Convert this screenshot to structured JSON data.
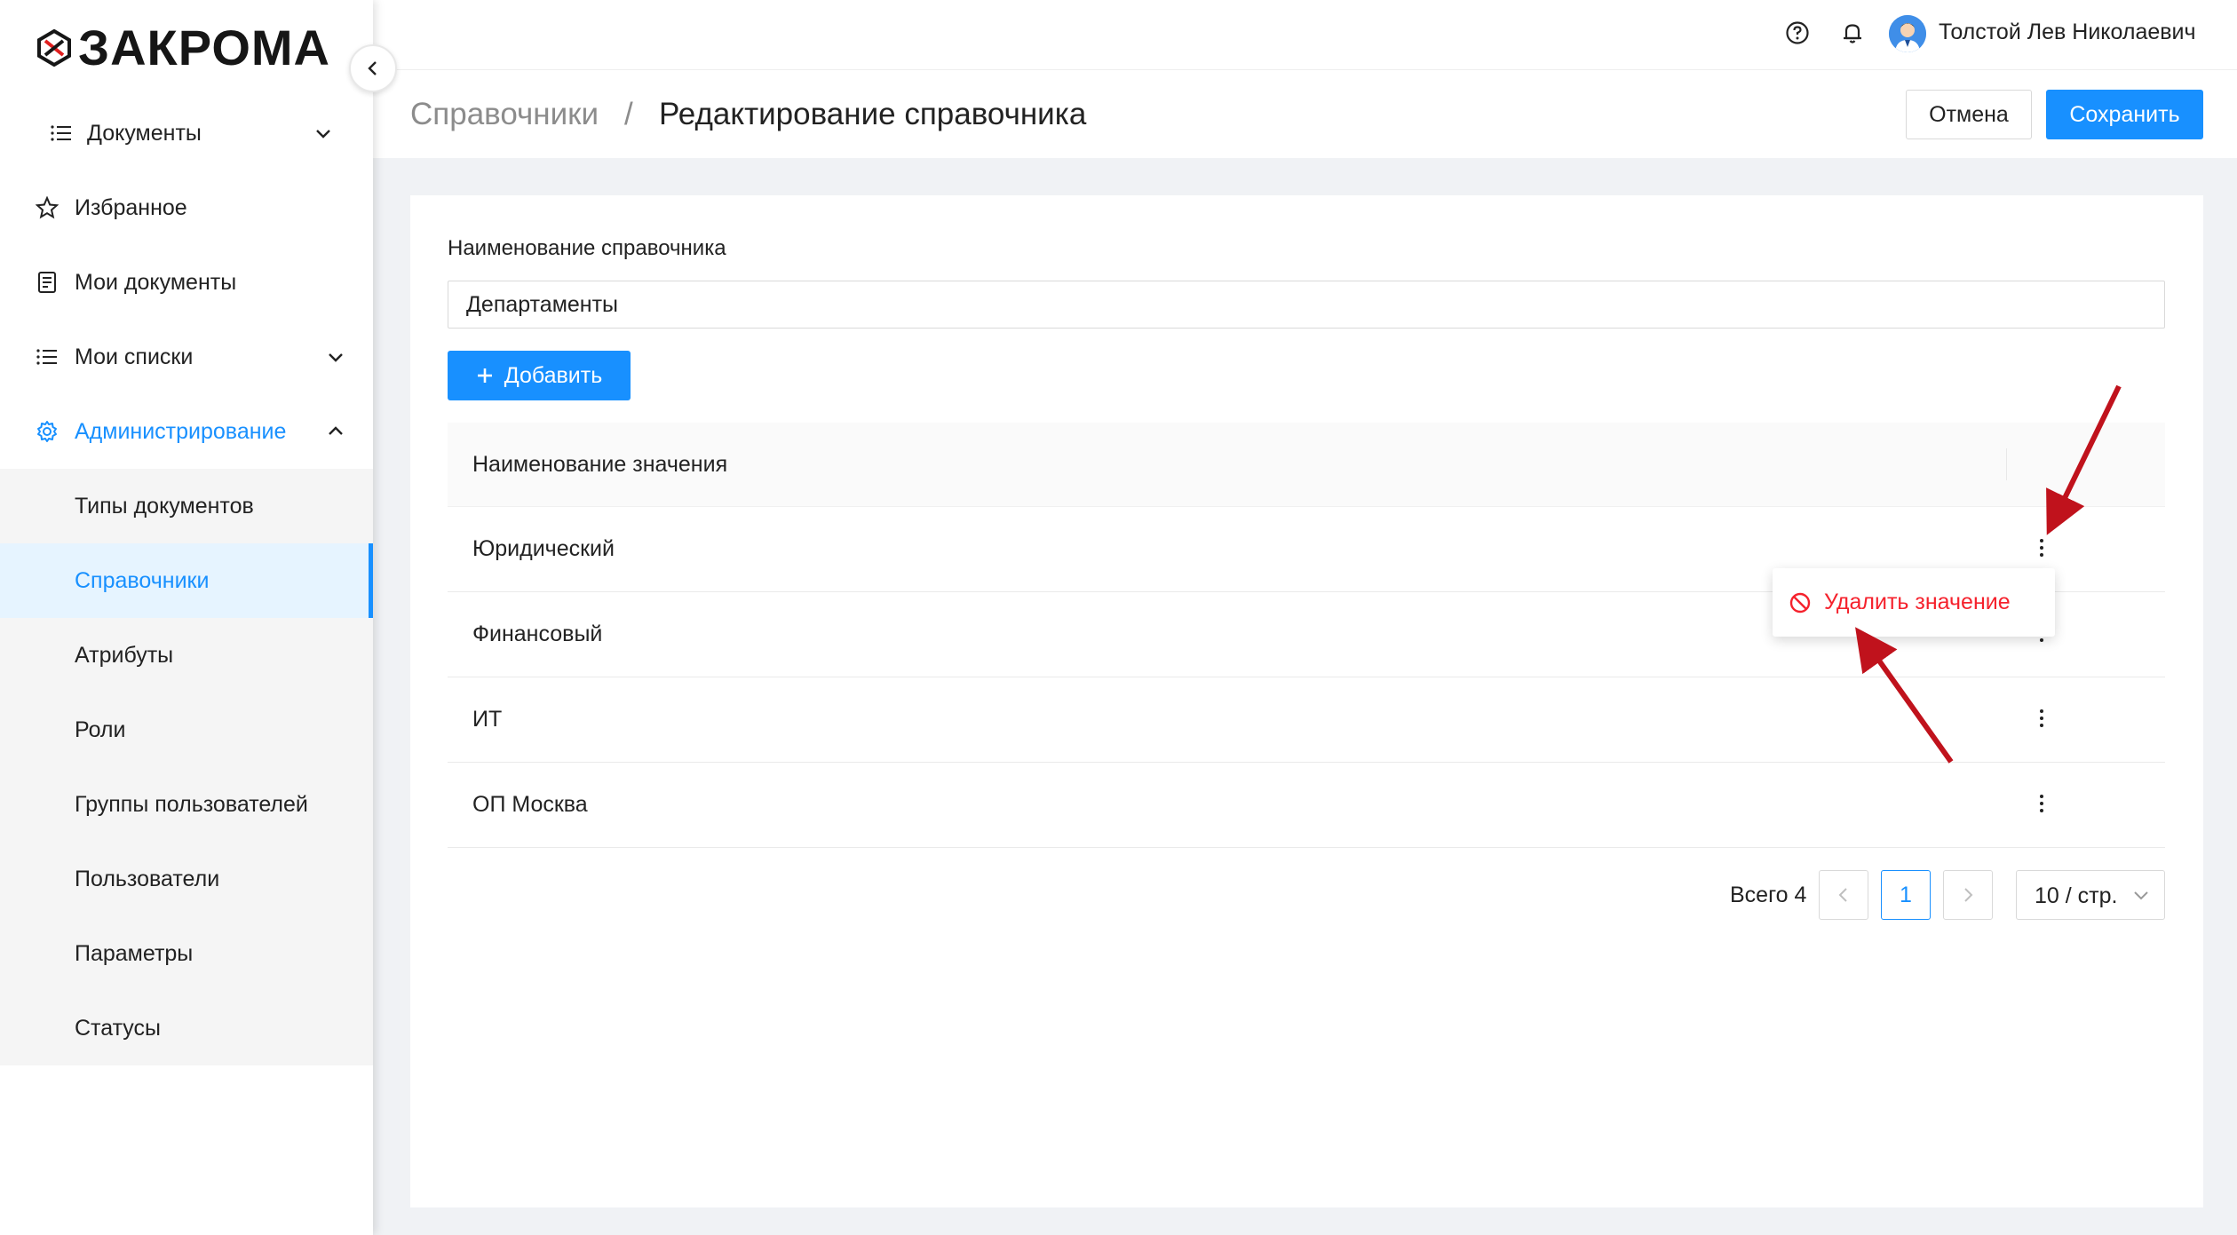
{
  "app": {
    "logo_text": "ЗАКРОМА"
  },
  "user": {
    "name": "Толстой Лев Николаевич"
  },
  "sidebar": {
    "items": [
      {
        "label": "Документы"
      },
      {
        "label": "Избранное"
      },
      {
        "label": "Мои документы"
      },
      {
        "label": "Мои списки"
      },
      {
        "label": "Администрирование"
      }
    ],
    "admin_sub": [
      {
        "label": "Типы документов"
      },
      {
        "label": "Справочники"
      },
      {
        "label": "Атрибуты"
      },
      {
        "label": "Роли"
      },
      {
        "label": "Группы пользователей"
      },
      {
        "label": "Пользователи"
      },
      {
        "label": "Параметры"
      },
      {
        "label": "Статусы"
      }
    ],
    "selected": "Справочники"
  },
  "breadcrumb": {
    "parent": "Справочники",
    "separator": "/",
    "current": "Редактирование справочника"
  },
  "actions": {
    "cancel_label": "Отмена",
    "save_label": "Сохранить"
  },
  "form": {
    "name_label": "Наименование справочника",
    "name_value": "Департаменты",
    "add_label": "Добавить"
  },
  "table": {
    "header": "Наименование значения",
    "rows": [
      "Юридический",
      "Финансовый",
      "ИТ",
      "ОП Москва"
    ]
  },
  "context_menu": {
    "delete_label": "Удалить значение"
  },
  "pagination": {
    "total_label": "Всего 4",
    "current_page": "1",
    "page_size": "10 / стр."
  },
  "colors": {
    "primary": "#1890ff",
    "danger": "#f5222d",
    "annotation_arrow": "#c0121c"
  }
}
